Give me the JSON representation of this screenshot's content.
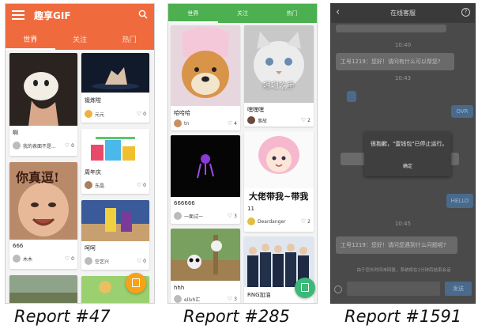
{
  "colors": {
    "orange": "#ef6b3e",
    "green": "#4caf50",
    "dialog_dark": "#3f3f3f",
    "blue_button": "#4a6a8c"
  },
  "report1": {
    "caption": "Report #47",
    "app_title": "趣享GIF",
    "icons": [
      "menu-icon",
      "search-icon",
      "heart-icon",
      "edit-icon"
    ],
    "tabs": [
      "世界",
      "关注",
      "热门"
    ],
    "cards": [
      {
        "caption": "啊",
        "user": "我的表面不是...",
        "likes": "0"
      },
      {
        "caption": "锻炼啦",
        "user": "元元",
        "likes": "0"
      },
      {
        "caption": "周年庆",
        "user": "东晶",
        "likes": "0"
      },
      {
        "caption": "666",
        "user": "木木",
        "likes": "0"
      },
      {
        "caption": "呵呵",
        "user": "空艺兴",
        "likes": "0"
      }
    ],
    "image_text": "你真逗!"
  },
  "report2": {
    "caption": "Report #285",
    "tabs": [
      "世界",
      "关注",
      "热门"
    ],
    "cards": [
      {
        "caption": "哈哈哈",
        "user": "tn",
        "likes": "4"
      },
      {
        "caption": "嘿嘿嘿",
        "user": "事故",
        "likes": "2"
      },
      {
        "caption": "666666",
        "user": "一面试一",
        "likes": "3"
      },
      {
        "caption": "11",
        "user": "Deardanger",
        "likes": "2"
      },
      {
        "caption": "hhh",
        "user": "ellvh汇",
        "likes": "3"
      },
      {
        "caption": "RNG加油",
        "user": "",
        "likes": ""
      }
    ],
    "image_texts": [
      "嗯嗯吃手",
      "大佬带我~带我"
    ]
  },
  "report3": {
    "caption": "Report #1591",
    "title": "在线客服",
    "times": [
      "10:40",
      "10:43",
      "10:45"
    ],
    "messages": [
      "工号1219：您好！请问有什么可以帮您?",
      "工号1219：您好！请问您遇到什么问题呢?"
    ],
    "blue_labels": [
      "OVR",
      "HELLO"
    ],
    "dialog_message": "很抱歉，\"壹钱包\"已停止运行。",
    "dialog_ok": "确定",
    "notice": "由于您长时间未回复，系统将在1分钟后结束会话",
    "send_label": "发送"
  }
}
